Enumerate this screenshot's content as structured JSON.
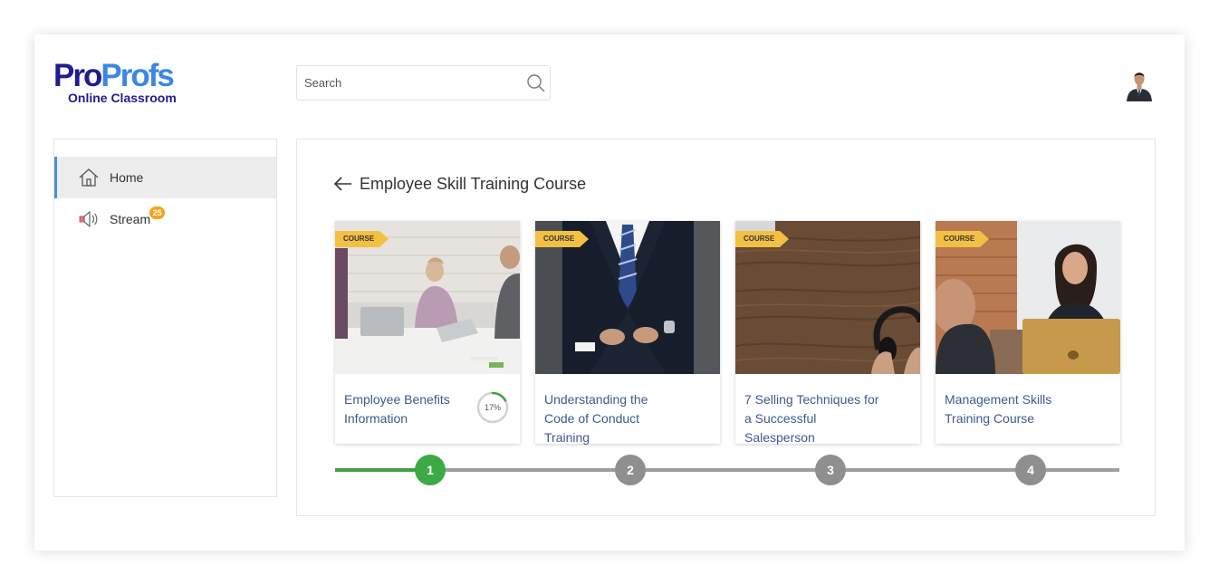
{
  "brand": {
    "logo_part1": "Pro",
    "logo_part2": "Profs",
    "logo_sub": "Online Classroom"
  },
  "search": {
    "placeholder": "Search",
    "value": ""
  },
  "sidebar": {
    "items": [
      {
        "label": "Home",
        "icon": "home-icon",
        "active": true
      },
      {
        "label": "Stream",
        "icon": "speaker-icon",
        "badge": "25"
      }
    ]
  },
  "course": {
    "title": "Employee Skill Training Course",
    "cards": [
      {
        "tag": "COURSE",
        "name": "Employee Benefits Information",
        "progress_label": "17%",
        "progress": 17
      },
      {
        "tag": "COURSE",
        "name": "Understanding the Code of Conduct Training"
      },
      {
        "tag": "COURSE",
        "name": "7 Selling Techniques for a Successful Salesperson"
      },
      {
        "tag": "COURSE",
        "name": "Management Skills Training Course"
      }
    ],
    "steps": [
      "1",
      "2",
      "3",
      "4"
    ],
    "current_step": 1
  },
  "colors": {
    "accent_blue": "#4a90d9",
    "done_green": "#3cab45",
    "tag_yellow": "#f3c043",
    "badge_orange": "#f5a11d",
    "link_blue": "#3d5a8f"
  }
}
